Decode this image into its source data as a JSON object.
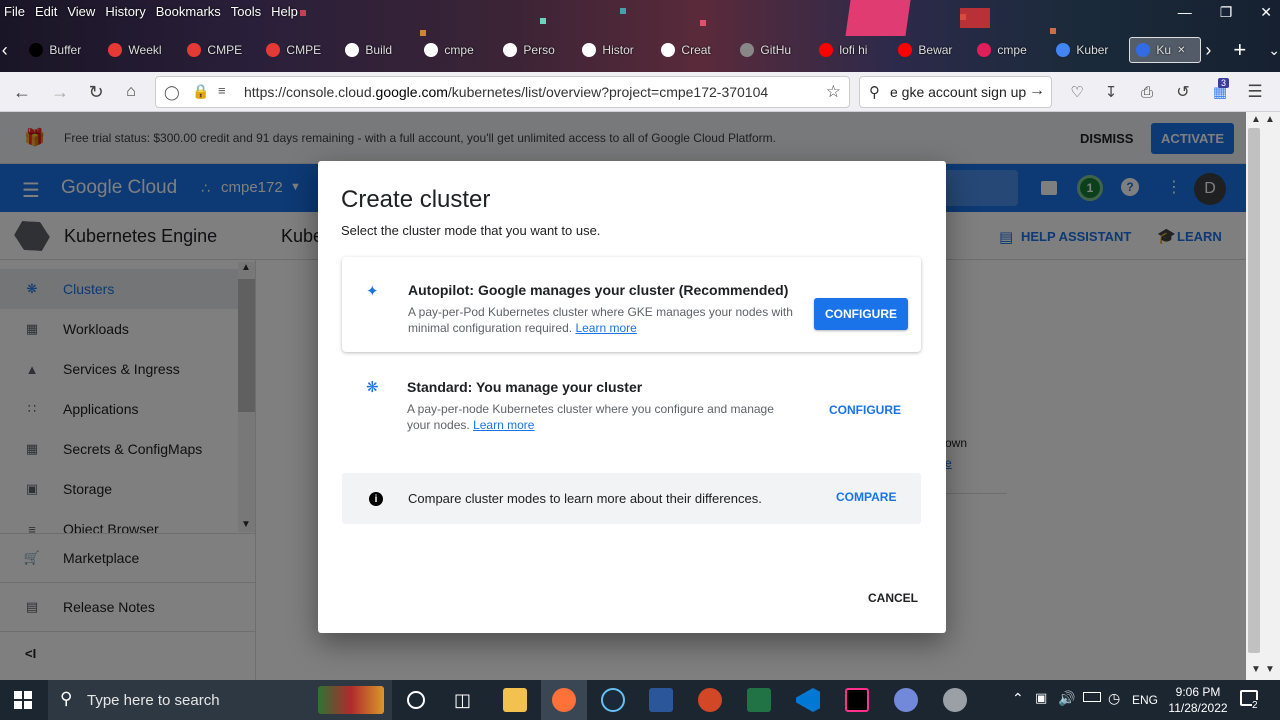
{
  "browser": {
    "menu": [
      "File",
      "Edit",
      "View",
      "History",
      "Bookmarks",
      "Tools",
      "Help"
    ],
    "tabs": [
      {
        "label": "Buffer",
        "icon": "medium-icon",
        "color": "#000000"
      },
      {
        "label": "Weekl",
        "icon": "red-ring-icon",
        "color": "#e53935"
      },
      {
        "label": "CMPE",
        "icon": "red-ring-icon",
        "color": "#e53935"
      },
      {
        "label": "CMPE",
        "icon": "red-ring-icon",
        "color": "#e53935"
      },
      {
        "label": "Build",
        "icon": "github-icon",
        "color": "#ffffff"
      },
      {
        "label": "cmpe",
        "icon": "github-icon",
        "color": "#ffffff"
      },
      {
        "label": "Perso",
        "icon": "github-icon",
        "color": "#ffffff"
      },
      {
        "label": "Histor",
        "icon": "github-icon",
        "color": "#ffffff"
      },
      {
        "label": "Creat",
        "icon": "github-icon",
        "color": "#ffffff"
      },
      {
        "label": "GitHu",
        "icon": "blank-icon",
        "color": "#888888"
      },
      {
        "label": "lofi hi",
        "icon": "youtube-icon",
        "color": "#ff0000"
      },
      {
        "label": "Bewar",
        "icon": "youtube-icon",
        "color": "#ff0000"
      },
      {
        "label": "cmpe",
        "icon": "slack-icon",
        "color": "#e01e5a"
      },
      {
        "label": "Kuber",
        "icon": "google-cloud-icon",
        "color": "#4285f4"
      },
      {
        "label": "Ku",
        "icon": "kubernetes-icon",
        "color": "#326ce5"
      }
    ],
    "url_prefix": "https://console.cloud.",
    "url_domain": "google.com",
    "url_suffix": "/kubernetes/list/overview?project=cmpe172-370104",
    "search_value": "e gke account sign up",
    "badge_count": "3"
  },
  "trial": {
    "text": "Free trial status: $300.00 credit and 91 days remaining - with a full account, you'll get unlimited access to all of Google Cloud Platform.",
    "dismiss": "DISMISS",
    "activate": "ACTIVATE"
  },
  "header": {
    "logo": "Google Cloud",
    "project": "cmpe172",
    "notif_count": "1",
    "avatar": "D"
  },
  "subheader": {
    "product": "Kubernetes Engine",
    "page_partial": "Kube",
    "help": "HELP ASSISTANT",
    "learn": "LEARN"
  },
  "sidebar": {
    "items": [
      {
        "label": "Clusters",
        "icon": "clusters-icon"
      },
      {
        "label": "Workloads",
        "icon": "workloads-icon"
      },
      {
        "label": "Services & Ingress",
        "icon": "services-icon"
      },
      {
        "label": "Applications",
        "icon": "applications-icon"
      },
      {
        "label": "Secrets & ConfigMaps",
        "icon": "secrets-icon"
      },
      {
        "label": "Storage",
        "icon": "storage-icon"
      },
      {
        "label": "Object Browser",
        "icon": "object-browser-icon"
      }
    ],
    "marketplace": "Marketplace",
    "release_notes": "Release Notes"
  },
  "background": {
    "frag1": "own",
    "frag2": "e"
  },
  "dialog": {
    "title": "Create cluster",
    "subtitle": "Select the cluster mode that you want to use.",
    "autopilot": {
      "title": "Autopilot: Google manages your cluster (Recommended)",
      "desc": "A pay-per-Pod Kubernetes cluster where GKE manages your nodes with minimal configuration required.",
      "learn_more": "Learn more",
      "button": "CONFIGURE"
    },
    "standard": {
      "title": "Standard: You manage your cluster",
      "desc": "A pay-per-node Kubernetes cluster where you configure and manage your nodes.",
      "learn_more": "Learn more",
      "button": "CONFIGURE"
    },
    "compare": {
      "text": "Compare cluster modes to learn more about their differences.",
      "button": "COMPARE"
    },
    "cancel": "CANCEL"
  },
  "taskbar": {
    "search_placeholder": "Type here to search",
    "time": "9:06 PM",
    "date": "11/28/2022",
    "lang": "ENG",
    "notif_count": "2"
  },
  "colors": {
    "accent": "#1a73e8",
    "header": "#1a73e8",
    "taskbar": "#1c2630"
  }
}
